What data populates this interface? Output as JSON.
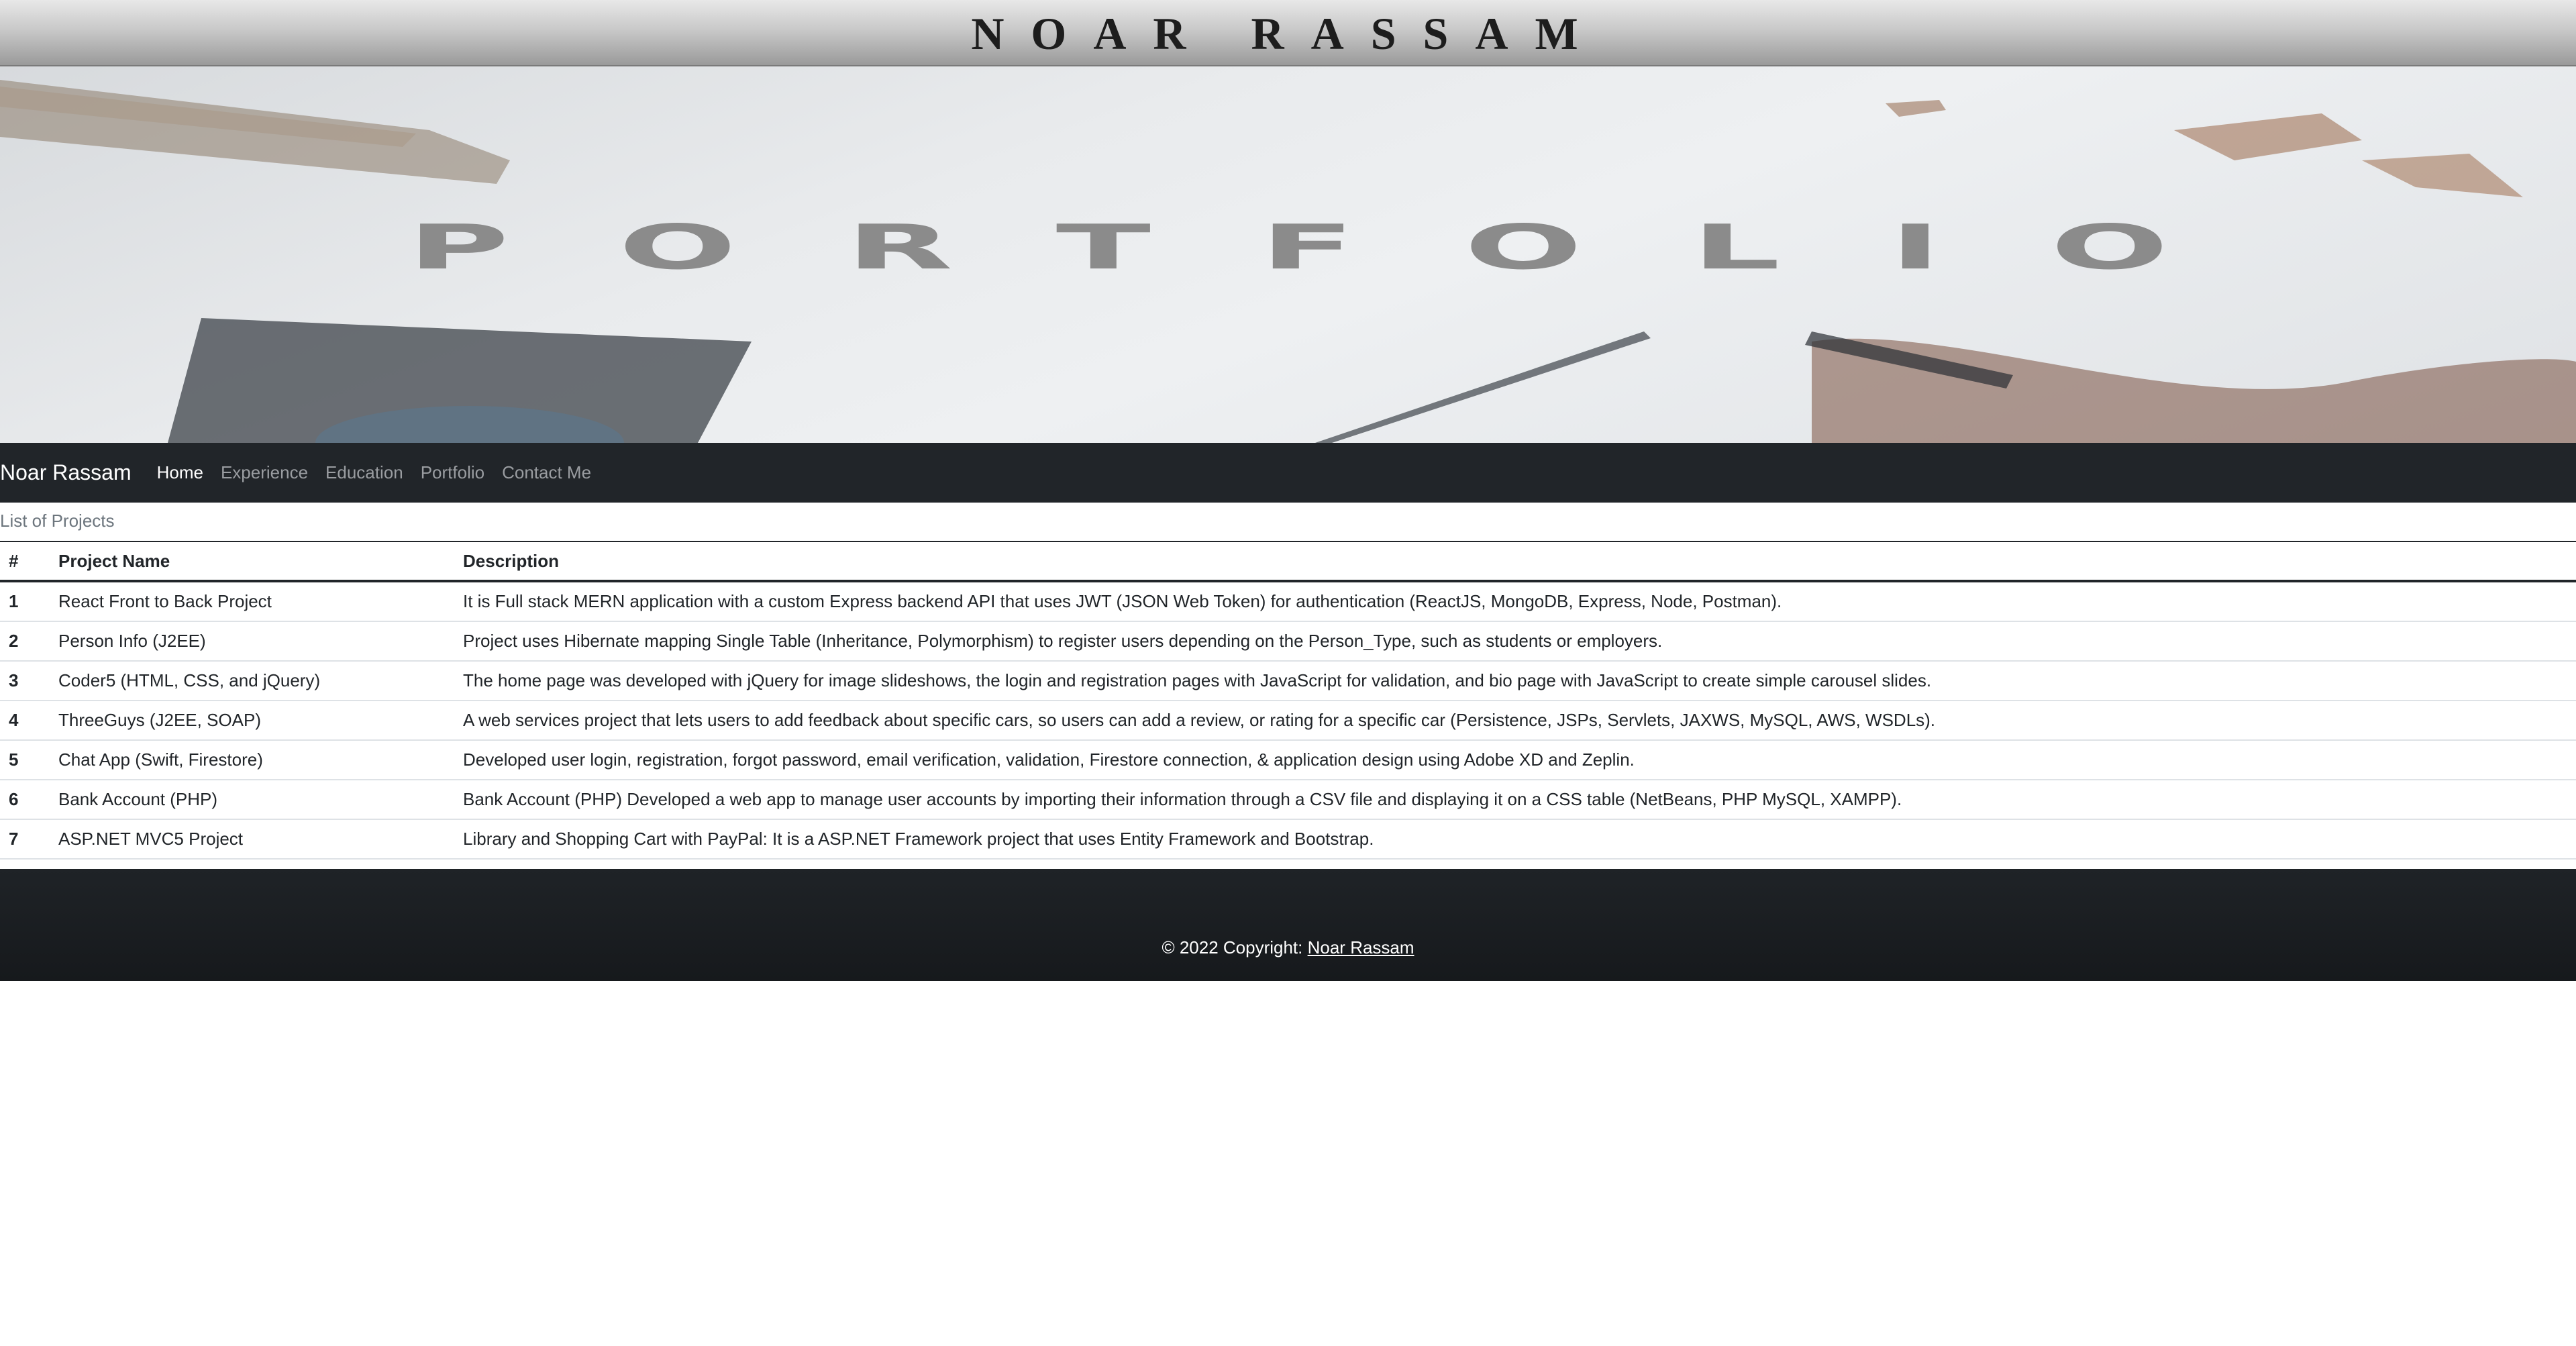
{
  "header": {
    "site_name": "NOAR RASSAM"
  },
  "hero": {
    "title": "PORTFOLIO"
  },
  "navbar": {
    "brand": "Noar Rassam",
    "links": [
      {
        "label": "Home",
        "active": true
      },
      {
        "label": "Experience",
        "active": false
      },
      {
        "label": "Education",
        "active": false
      },
      {
        "label": "Portfolio",
        "active": false
      },
      {
        "label": "Contact Me",
        "active": false
      }
    ]
  },
  "projects": {
    "caption": "List of Projects",
    "columns": [
      "#",
      "Project Name",
      "Description"
    ],
    "rows": [
      {
        "num": "1",
        "name": "React Front to Back Project",
        "description": "It is Full stack MERN application with a custom Express backend API that uses JWT (JSON Web Token) for authentication (ReactJS, MongoDB, Express, Node, Postman)."
      },
      {
        "num": "2",
        "name": "Person Info (J2EE)",
        "description": "Project uses Hibernate mapping Single Table (Inheritance, Polymorphism) to register users depending on the Person_Type, such as students or employers."
      },
      {
        "num": "3",
        "name": "Coder5 (HTML, CSS, and jQuery)",
        "description": "The home page was developed with jQuery for image slideshows, the login and registration pages with JavaScript for validation, and bio page with JavaScript to create simple carousel slides."
      },
      {
        "num": "4",
        "name": "ThreeGuys (J2EE, SOAP)",
        "description": "A web services project that lets users to add feedback about specific cars, so users can add a review, or rating for a specific car (Persistence, JSPs, Servlets, JAXWS, MySQL, AWS, WSDLs)."
      },
      {
        "num": "5",
        "name": "Chat App (Swift, Firestore)",
        "description": "Developed user login, registration, forgot password, email verification, validation, Firestore connection, & application design using Adobe XD and Zeplin."
      },
      {
        "num": "6",
        "name": "Bank Account (PHP)",
        "description": "Bank Account (PHP) Developed a web app to manage user accounts by importing their information through a CSV file and displaying it on a CSS table (NetBeans, PHP MySQL, XAMPP)."
      },
      {
        "num": "7",
        "name": "ASP.NET MVC5 Project",
        "description": "Library and Shopping Cart with PayPal: It is a ASP.NET Framework project that uses Entity Framework and Bootstrap."
      }
    ]
  },
  "footer": {
    "copyright": "© 2022 Copyright: ",
    "link": "Noar Rassam"
  }
}
